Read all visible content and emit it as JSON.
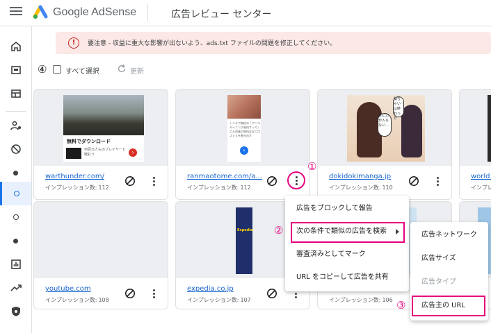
{
  "header": {
    "brand": "Google AdSense",
    "title": "広告レビュー センター"
  },
  "banner": {
    "icon": "!",
    "text": "要注意 - 収益に重大な影響が出ないよう、ads.txt ファイルの問題を修正してください。"
  },
  "toolbar": {
    "select_all": "すべて選択",
    "refresh": "更新"
  },
  "impressions_label": "インプレッション数:",
  "cards": [
    {
      "domain": "warthunder.com/",
      "impressions": "112",
      "ad_caption": "無料でダウンロード",
      "ad_small": "何百万人ものプレイヤーと戦おう"
    },
    {
      "domain": "ranmaotome.com/a...",
      "impressions": "112",
      "ad_small": "トンキで無料の「アソコキーニング歯科サっで」工土前乗の無料は全て月２０６を着分出す"
    },
    {
      "domain": "dokidokimanga.jp",
      "impressions": "110",
      "ad_bubble1": "足に力が入らない…",
      "ad_bubble2": "駄ちゃいは終わった"
    },
    {
      "domain": "world.",
      "impressions": ""
    },
    {
      "domain": "youtube.com",
      "impressions": "108"
    },
    {
      "domain": "expedia.co.jp",
      "impressions": "107",
      "ad_brand": "Expedia"
    },
    {
      "domain": "",
      "impressions": "106"
    }
  ],
  "context_menu": {
    "items": [
      "広告をブロックして報告",
      "次の条件で類似の広告を検索",
      "審査済みとしてマーク",
      "URL をコピーして広告を共有"
    ]
  },
  "submenu": {
    "items": [
      "広告ネットワーク",
      "広告サイズ",
      "広告タイプ",
      "広告主の URL"
    ]
  },
  "steps": [
    "①",
    "②",
    "③",
    "④"
  ],
  "colors": {
    "highlight": "#e4007f",
    "accent": "#1a73e8",
    "warning_bg": "#fce8e6"
  }
}
